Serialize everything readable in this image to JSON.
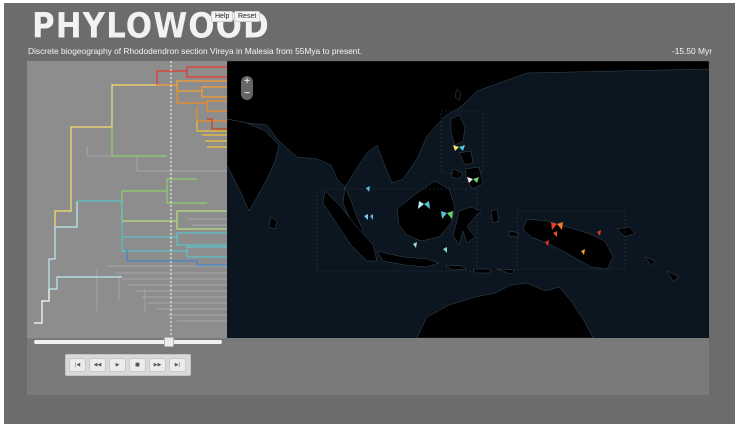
{
  "header": {
    "logo_text": "PHYLOWOOD",
    "help_label": "Help",
    "reset_label": "Reset"
  },
  "caption": "Discrete biogeography of Rhododendron section Vireya in Malesia from 55Mya to present.",
  "time_readout": "-15.50 Myr",
  "timeline": {
    "position_fraction": 0.72
  },
  "zoom": {
    "in_symbol": "+",
    "out_symbol": "−"
  },
  "transport": {
    "first_symbol": "|◀",
    "back_symbol": "◀◀",
    "play_symbol": "▶",
    "stop_symbol": "■",
    "forward_symbol": "▶▶",
    "last_symbol": "▶|"
  },
  "colors": {
    "background": "#6c6c6c",
    "tree_panel": "#8d8d8d",
    "ocean": "#0b1620",
    "land": "#000000"
  },
  "icons": [
    "plus-icon",
    "minus-icon",
    "skip-first-icon",
    "step-back-icon",
    "play-icon",
    "stop-icon",
    "step-forward-icon",
    "skip-last-icon"
  ]
}
